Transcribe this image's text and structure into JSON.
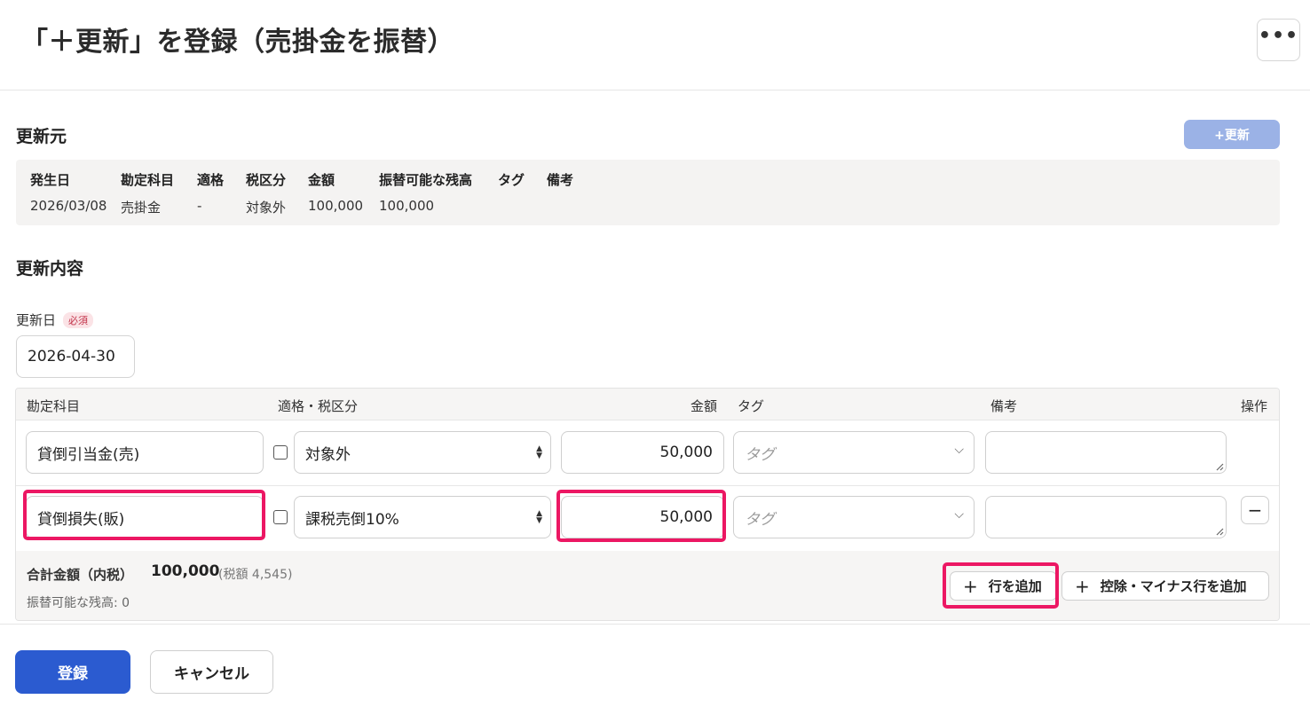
{
  "page": {
    "title": "「＋更新」を登録（売掛金を振替）",
    "more_label": "•••"
  },
  "source": {
    "section_title": "更新元",
    "update_button": "+更新",
    "headers": [
      "発生日",
      "勘定科目",
      "適格",
      "税区分",
      "金額",
      "振替可能な残高",
      "タグ",
      "備考"
    ],
    "values": [
      "2026/03/08",
      "売掛金",
      "-",
      "対象外",
      "100,000",
      "100,000",
      "",
      ""
    ]
  },
  "content": {
    "section_title": "更新内容",
    "date_label": "更新日",
    "required_badge": "必須",
    "date_value": "2026-04-30"
  },
  "table": {
    "headers": {
      "account": "勘定科目",
      "tax": "適格・税区分",
      "amount": "金額",
      "tag": "タグ",
      "memo": "備考",
      "ops": "操作"
    },
    "rows": [
      {
        "account": "貸倒引当金(売)",
        "tax": "対象外",
        "amount": "50,000",
        "tag_placeholder": "タグ",
        "memo": ""
      },
      {
        "account": "貸倒損失(販)",
        "tax": "課税売倒10%",
        "amount": "50,000",
        "tag_placeholder": "タグ",
        "memo": ""
      }
    ],
    "minus_label": "−",
    "total_label": "合計金額（内税）",
    "total_value": "100,000",
    "total_tax": "(税額 4,545)",
    "remaining": "振替可能な残高: 0",
    "add_row": "行を追加",
    "add_deduct_row": "控除・マイナス行を追加"
  },
  "actions": {
    "submit": "登録",
    "cancel": "キャンセル"
  },
  "colors": {
    "primary": "#2b5bd0",
    "highlight": "#ec1763",
    "disabled_button": "#9bb2e6"
  }
}
